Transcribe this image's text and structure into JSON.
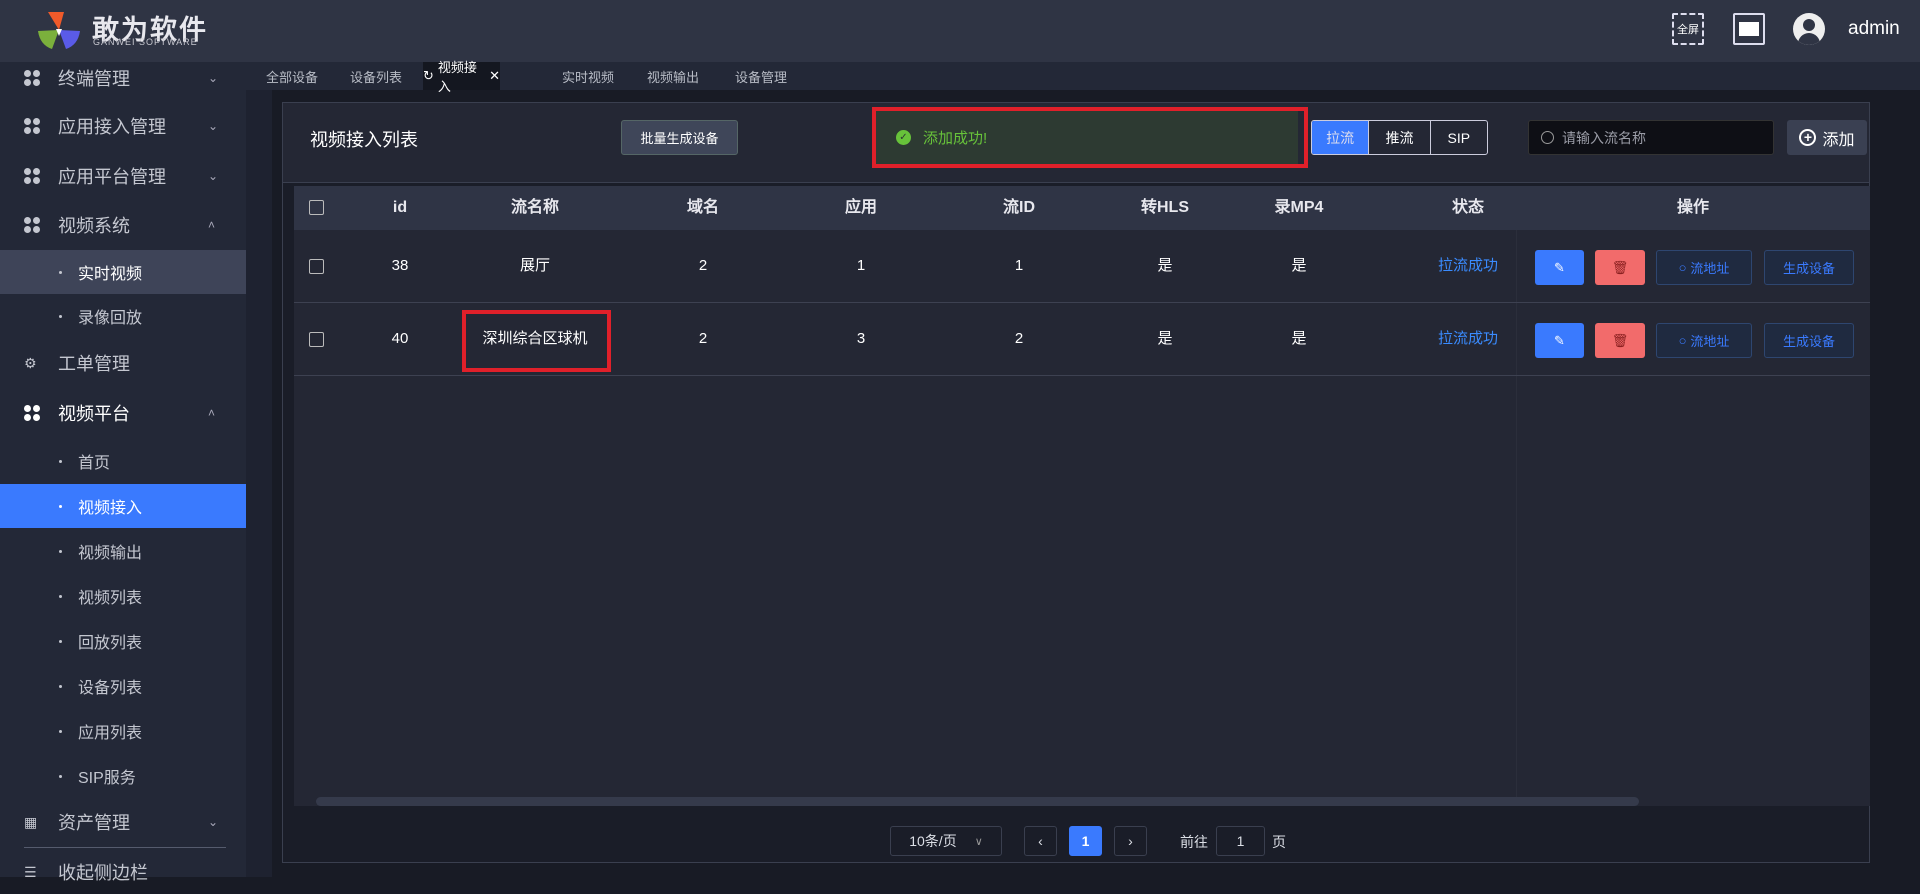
{
  "header": {
    "logo_title": "敢为软件",
    "logo_subtitle": "GANWEI SOFTWARE",
    "fullscreen_label": "全屏",
    "username": "admin"
  },
  "sidebar": {
    "items": [
      {
        "label": "终端管理"
      },
      {
        "label": "应用接入管理"
      },
      {
        "label": "应用平台管理"
      },
      {
        "label": "视频系统"
      },
      {
        "label": "实时视频"
      },
      {
        "label": "录像回放"
      },
      {
        "label": "工单管理"
      },
      {
        "label": "视频平台"
      },
      {
        "label": "首页"
      },
      {
        "label": "视频接入"
      },
      {
        "label": "视频输出"
      },
      {
        "label": "视频列表"
      },
      {
        "label": "回放列表"
      },
      {
        "label": "设备列表"
      },
      {
        "label": "应用列表"
      },
      {
        "label": "SIP服务"
      },
      {
        "label": "资产管理"
      },
      {
        "label": "收起侧边栏"
      }
    ]
  },
  "tabs": [
    {
      "label": "全部设备"
    },
    {
      "label": "设备列表"
    },
    {
      "label": "视频接入",
      "active": true
    },
    {
      "label": "实时视频"
    },
    {
      "label": "视频输出"
    },
    {
      "label": "设备管理"
    }
  ],
  "card": {
    "title": "视频接入列表",
    "batch_button": "批量生成设备",
    "toast": "添加成功!",
    "segments": [
      "拉流",
      "推流",
      "SIP"
    ],
    "search_placeholder": "请输入流名称",
    "add_button": "添加"
  },
  "table": {
    "headers": [
      "id",
      "流名称",
      "域名",
      "应用",
      "流ID",
      "转HLS",
      "录MP4",
      "状态",
      "操作"
    ],
    "rows": [
      {
        "id": "38",
        "name": "展厅",
        "domain": "2",
        "app": "1",
        "stream_id": "1",
        "hls": "是",
        "mp4": "是",
        "status": "拉流成功",
        "url_btn": "流地址",
        "gen_btn": "生成设备"
      },
      {
        "id": "40",
        "name": "深圳综合区球机",
        "domain": "2",
        "app": "3",
        "stream_id": "2",
        "hls": "是",
        "mp4": "是",
        "status": "拉流成功",
        "url_btn": "流地址",
        "gen_btn": "生成设备"
      }
    ]
  },
  "pagination": {
    "page_size": "10条/页",
    "current_page": "1",
    "goto_label": "前往",
    "goto_value": "1",
    "page_suffix": "页"
  },
  "colors": {
    "accent": "#3a7afe",
    "danger": "#f26b6b",
    "success": "#67c23a",
    "highlight": "#e0202a"
  }
}
